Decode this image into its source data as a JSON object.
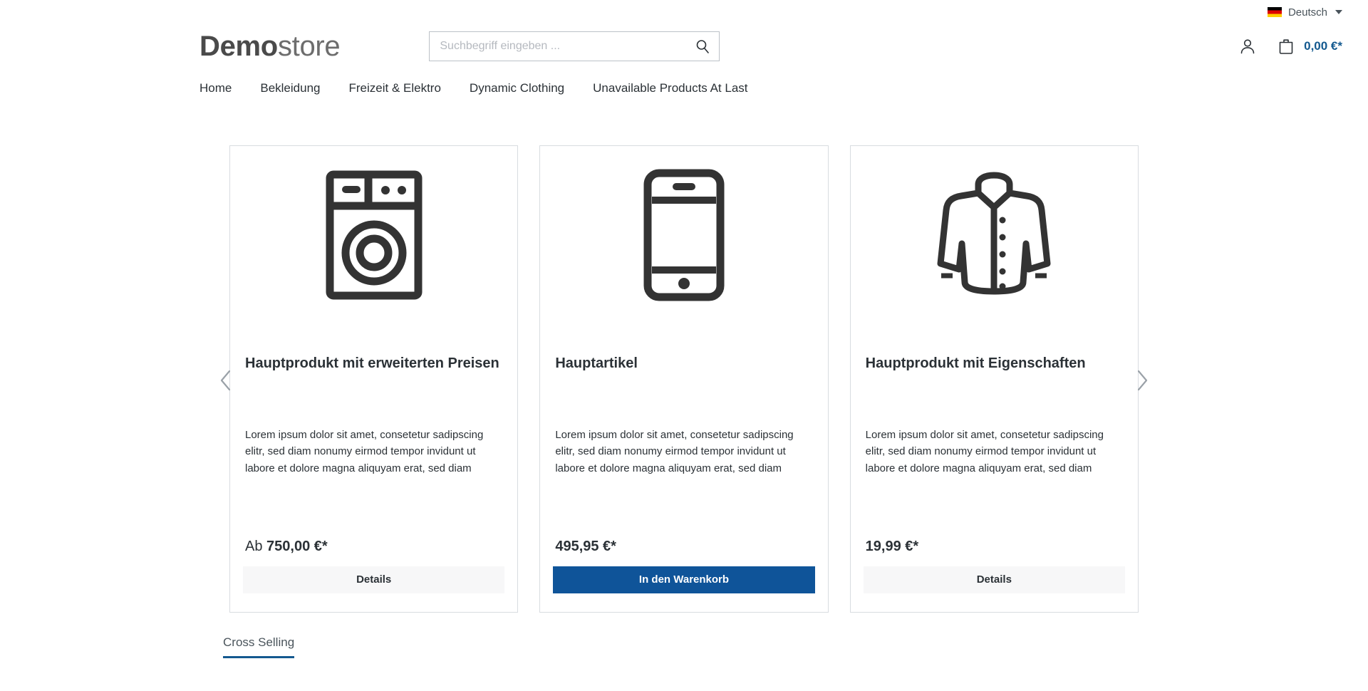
{
  "topbar": {
    "language": {
      "label": "Deutsch",
      "flag_icon": "german-flag-icon"
    }
  },
  "header": {
    "logo_bold": "Demo",
    "logo_light": "store",
    "search": {
      "placeholder": "Suchbegriff eingeben ...",
      "value": "",
      "icon": "search-icon"
    },
    "account_icon": "user-icon",
    "cart_icon": "cart-bag-icon",
    "cart_total": "0,00 €*"
  },
  "nav": {
    "items": [
      {
        "label": "Home"
      },
      {
        "label": "Bekleidung"
      },
      {
        "label": "Freizeit & Elektro"
      },
      {
        "label": "Dynamic Clothing"
      },
      {
        "label": "Unavailable Products At Last"
      }
    ]
  },
  "slider": {
    "prev_icon": "chevron-left-icon",
    "next_icon": "chevron-right-icon",
    "cards": [
      {
        "image_icon": "washing-machine-icon",
        "title": "Hauptprodukt mit erweiterten Preisen",
        "description": "Lorem ipsum dolor sit amet, consetetur sadipscing elitr, sed diam nonumy eirmod tempor invidunt ut labore et dolore magna aliquyam erat, sed diam voluptua. At ver...",
        "price_prefix": "Ab ",
        "price": "750,00 €*",
        "button_label": "Details",
        "button_style": "secondary"
      },
      {
        "image_icon": "smartphone-icon",
        "title": "Hauptartikel",
        "description": "Lorem ipsum dolor sit amet, consetetur sadipscing elitr, sed diam nonumy eirmod tempor invidunt ut labore et dolore magna aliquyam erat, sed diam voluptua. At ver...",
        "price_prefix": "",
        "price": "495,95 €*",
        "button_label": "In den Warenkorb",
        "button_style": "primary"
      },
      {
        "image_icon": "jacket-icon",
        "title": "Hauptprodukt mit Eigenschaften",
        "description": "Lorem ipsum dolor sit amet, consetetur sadipscing elitr, sed diam nonumy eirmod tempor invidunt ut labore et dolore magna aliquyam erat, sed diam voluptua. At ver...",
        "price_prefix": "",
        "price": "19,99 €*",
        "button_label": "Details",
        "button_style": "secondary"
      }
    ]
  },
  "tabs": {
    "items": [
      {
        "label": "Cross Selling",
        "active": true
      }
    ]
  },
  "colors": {
    "accent": "#0f5499",
    "link": "#13598f",
    "text": "#2b3136",
    "border": "#d8dce0"
  }
}
